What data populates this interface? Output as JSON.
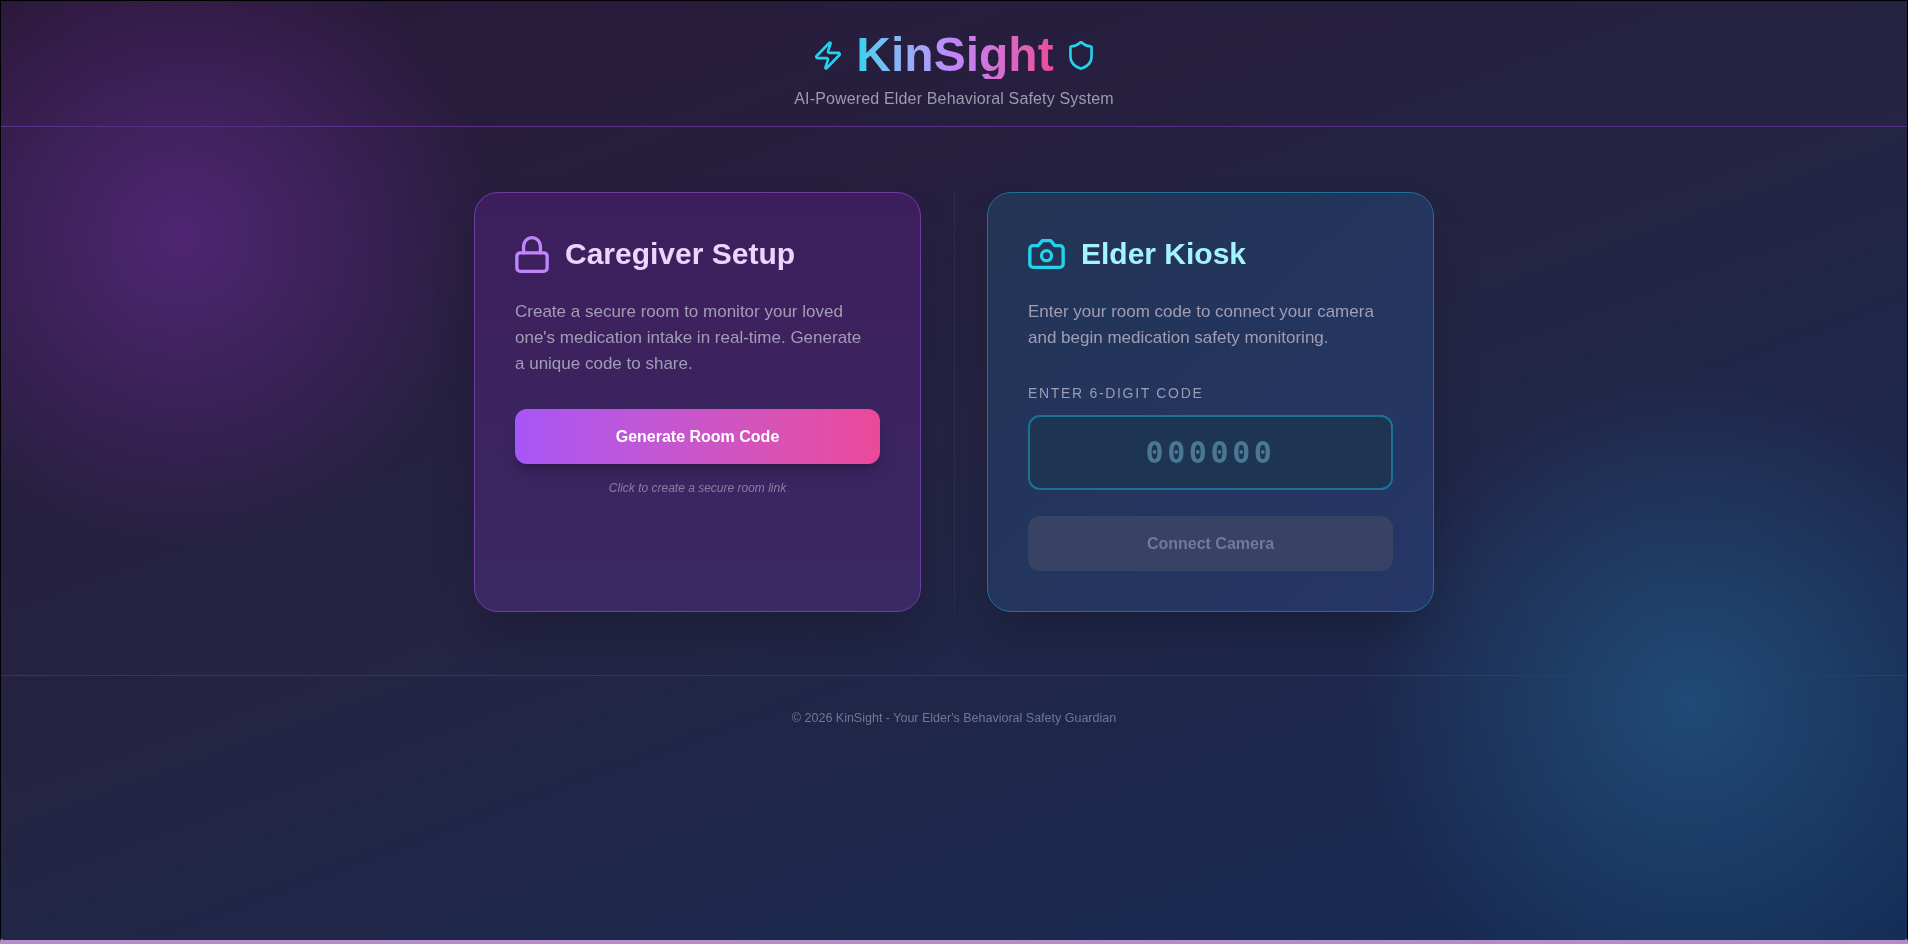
{
  "header": {
    "title": "KinSight",
    "subtitle": "AI-Powered Elder Behavioral Safety System"
  },
  "cards": [
    {
      "kind": "caregiver",
      "title": "Caregiver Setup",
      "description": "Create a secure room to monitor your loved one's medication intake in real-time. Generate a unique code to share.",
      "button": {
        "label": "Generate Room Code",
        "disabled": false
      },
      "hint": "Click to create a secure room link"
    },
    {
      "kind": "kiosk",
      "title": "Elder Kiosk",
      "description": "Enter your room code to connect your camera and begin medication safety monitoring.",
      "field": {
        "label": "ENTER 6-DIGIT CODE",
        "placeholder": "000000"
      },
      "button": {
        "label": "Connect Camera",
        "disabled": true
      }
    }
  ],
  "footer": {
    "text": "© 2026 KinSight - Your Elder's Behavioral Safety Guardian"
  }
}
